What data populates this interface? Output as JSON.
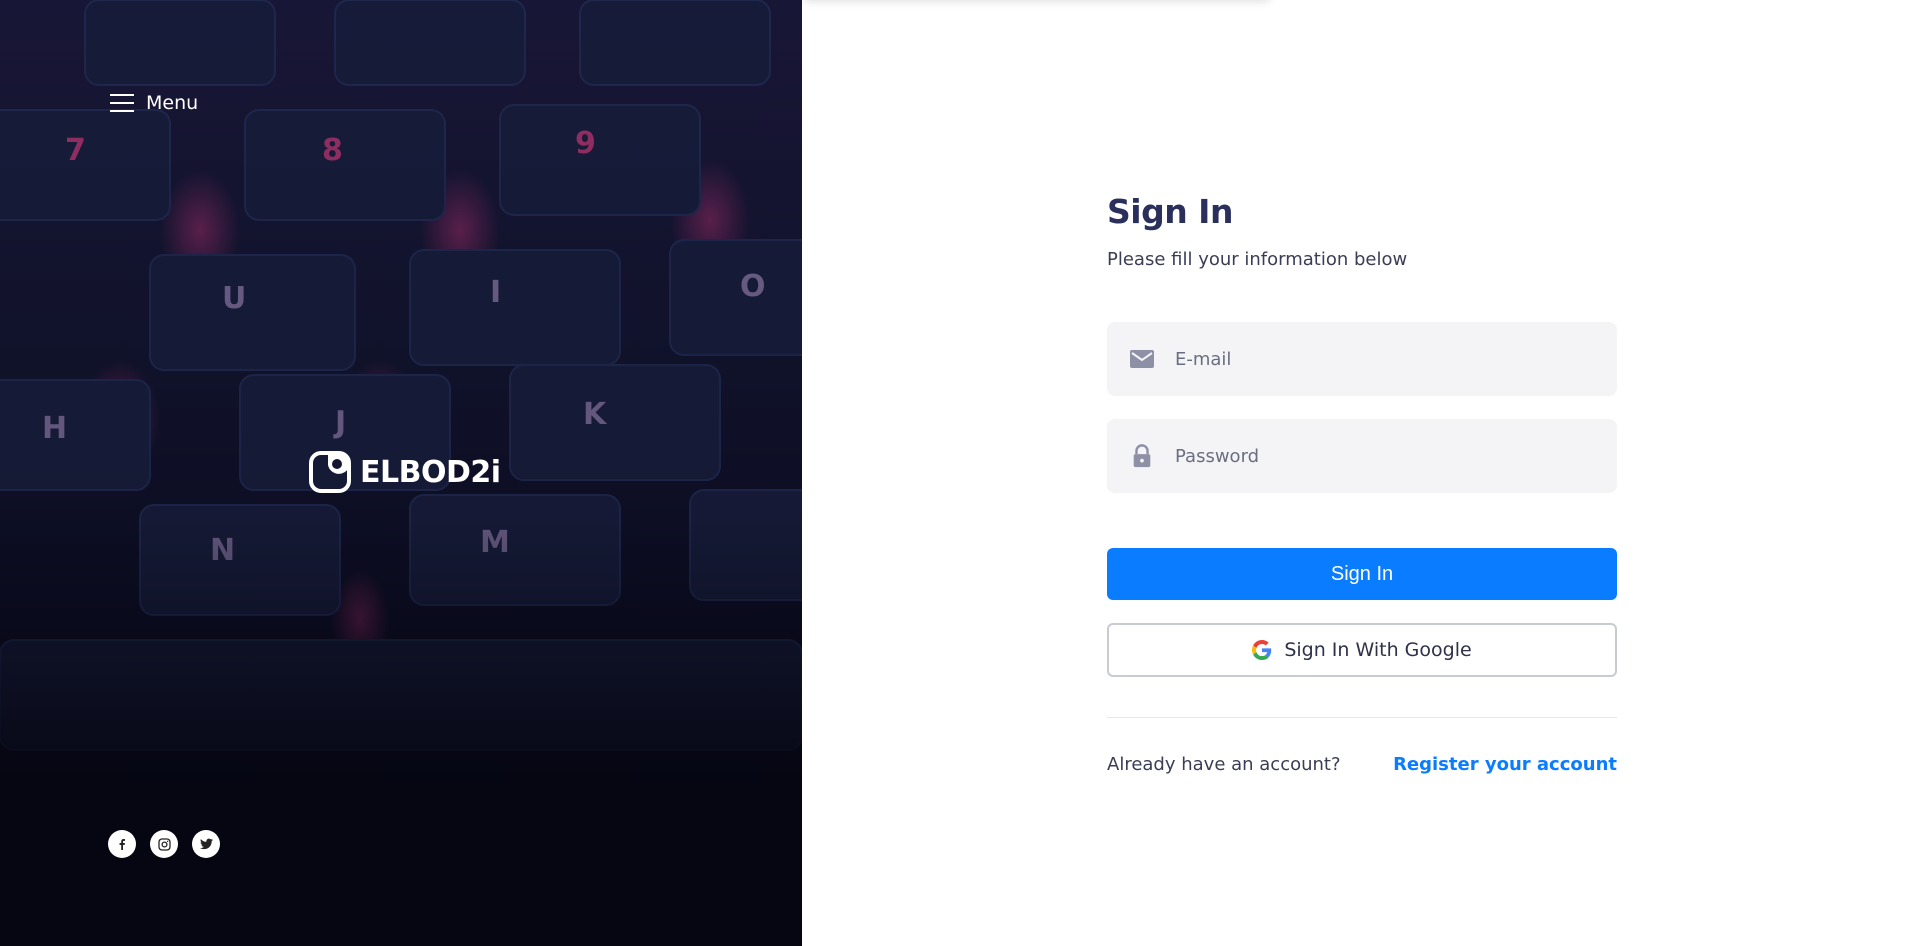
{
  "left_panel": {
    "menu_label": "Menu",
    "brand_name": "ELBOD2i",
    "key_letters": [
      "7",
      "8",
      "9",
      "U",
      "I",
      "O",
      "H",
      "J",
      "K",
      "N",
      "M"
    ],
    "socials": [
      {
        "name": "facebook-icon",
        "glyph": "f"
      },
      {
        "name": "instagram-icon",
        "glyph": ""
      },
      {
        "name": "twitter-icon",
        "glyph": ""
      }
    ]
  },
  "form": {
    "title": "Sign In",
    "subtitle": "Please fill your information below",
    "email_placeholder": "E-mail",
    "password_placeholder": "Password",
    "sign_in_label": "Sign In",
    "google_label": "Sign In With Google",
    "already_text": "Already have an account?",
    "register_text": "Register your account"
  },
  "colors": {
    "accent": "#0a7cff",
    "heading": "#2a2f5b",
    "input_bg": "#f4f4f7",
    "left_bg": "#141631",
    "key_glow": "#d2387f"
  }
}
